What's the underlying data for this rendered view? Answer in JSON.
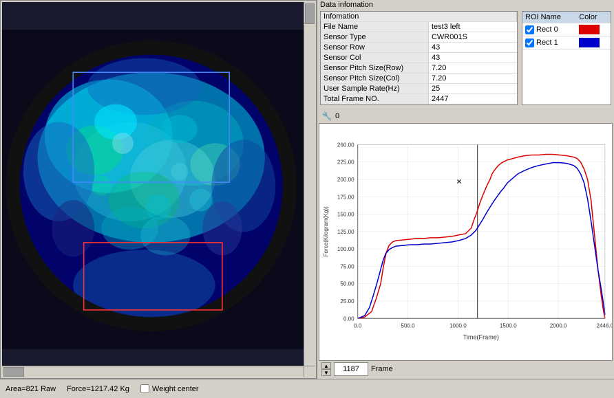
{
  "header": {
    "data_info_title": "Data infomation"
  },
  "info_table": {
    "header": "Infomation",
    "rows": [
      {
        "label": "File Name",
        "value": "test3 left"
      },
      {
        "label": "Sensor Type",
        "value": "CWR001S"
      },
      {
        "label": "Sensor Row",
        "value": "43"
      },
      {
        "label": "Sensor Col",
        "value": "43"
      },
      {
        "label": "Sensor Pitch Size(Row)",
        "value": "7.20"
      },
      {
        "label": "Sensor Pitch Size(Col)",
        "value": "7.20"
      },
      {
        "label": "User Sample Rate(Hz)",
        "value": "25"
      },
      {
        "label": "Total Frame NO.",
        "value": "2447"
      }
    ]
  },
  "roi_table": {
    "name_header": "ROI Name",
    "color_header": "Color",
    "rows": [
      {
        "checked": true,
        "name": "Rect 0",
        "color": "red"
      },
      {
        "checked": true,
        "name": "Rect 1",
        "color": "blue"
      }
    ]
  },
  "chart": {
    "toolbar_icon": "🔧",
    "toolbar_value": "0",
    "y_label": "Force(Kilogram(Kg))",
    "x_label": "Time(Frame)",
    "y_ticks": [
      "260.00",
      "225.00",
      "200.00",
      "175.00",
      "150.00",
      "125.00",
      "100.00",
      "75.00",
      "50.00",
      "25.00",
      "0.00"
    ],
    "x_ticks": [
      "0.0",
      "500.0",
      "1000.0",
      "1500.0",
      "2000.0",
      "2446.0"
    ]
  },
  "status_bar": {
    "area": "Area=821 Raw",
    "force": "Force=1217.42 Kg",
    "weight_center_label": "Weight center",
    "frame_label": "Frame",
    "frame_value": "1187"
  }
}
